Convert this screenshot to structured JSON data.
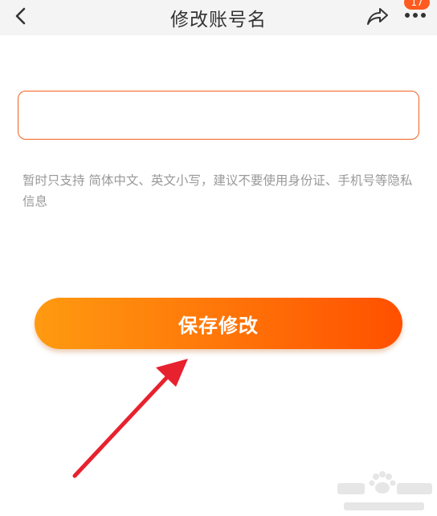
{
  "header": {
    "title": "修改账号名",
    "back_icon": "chevron-left-icon",
    "share_icon": "share-icon",
    "more_icon": "more-dots-icon",
    "badge_count": "17"
  },
  "form": {
    "account_name_value": "",
    "hint_text": "暂时只支持 简体中文、英文小写，建议不要使用身份证、手机号等隐私信息"
  },
  "actions": {
    "save_label": "保存修改"
  },
  "colors": {
    "accent": "#f0621d",
    "button_start": "#ff9a10",
    "button_end": "#ff5000",
    "arrow": "#e8212f",
    "hint": "#999999",
    "header_bg": "#f4f4f4"
  }
}
